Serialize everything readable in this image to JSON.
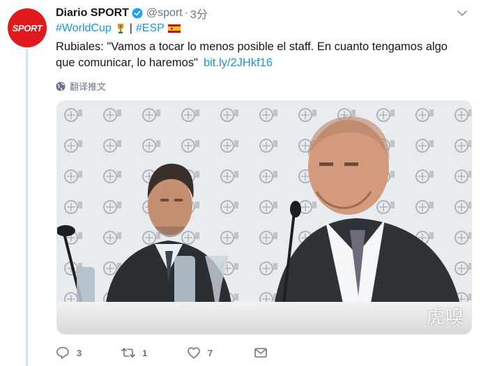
{
  "author": {
    "avatar_text": "SPORT",
    "display_name": "Diario SPORT",
    "handle": "@sport",
    "separator": "·",
    "time": "3分",
    "verified": true
  },
  "hashtags": {
    "first": "#WorldCup",
    "divider": "|",
    "second": "#ESP"
  },
  "tweet": {
    "text": "Rubiales: \"Vamos a tocar lo menos posible el staff. En cuanto tengamos algo que comunicar, lo haremos\"",
    "link": "bit.ly/2JHkf16"
  },
  "translate_label": "翻译推文",
  "media": {
    "watermark": "虎嗅"
  },
  "actions": {
    "reply_count": "3",
    "retweet_count": "1",
    "like_count": "7"
  },
  "colors": {
    "link": "#1b95e0",
    "secondary": "#657786",
    "brand": "#e0191e",
    "thread_line": "#c4e6f8"
  },
  "icons": [
    "verified-icon",
    "chevron-down-icon",
    "trophy-icon",
    "spain-flag-icon",
    "globe-icon",
    "reply-icon",
    "retweet-icon",
    "like-icon",
    "direct-message-icon"
  ]
}
